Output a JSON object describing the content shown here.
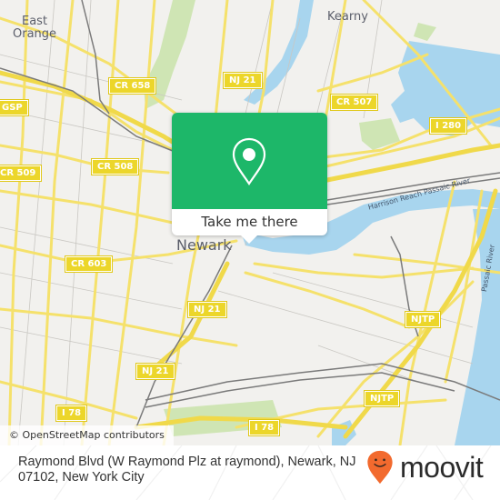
{
  "map": {
    "places": [
      {
        "name": "East Orange",
        "lines": [
          "East",
          "Orange"
        ]
      },
      {
        "name": "Kearny"
      },
      {
        "name": "Newark"
      }
    ],
    "road_shields": [
      {
        "id": "cr658",
        "label": "CR 658"
      },
      {
        "id": "nj21-top",
        "label": "NJ 21"
      },
      {
        "id": "cr507",
        "label": "CR 507"
      },
      {
        "id": "gsp",
        "label": "GSP"
      },
      {
        "id": "i280",
        "label": "I 280"
      },
      {
        "id": "cr509",
        "label": "CR 509"
      },
      {
        "id": "cr508",
        "label": "CR 508"
      },
      {
        "id": "cr603",
        "label": "CR 603"
      },
      {
        "id": "nj21-mid",
        "label": "NJ 21"
      },
      {
        "id": "njtp-upper",
        "label": "NJTP"
      },
      {
        "id": "nj21-low",
        "label": "NJ 21"
      },
      {
        "id": "njtp-lower",
        "label": "NJTP"
      },
      {
        "id": "i78-left",
        "label": "I 78"
      },
      {
        "id": "i78-right",
        "label": "I 78"
      }
    ],
    "water_labels": [
      {
        "id": "harrison-reach",
        "label": "Harrison Reach Passaic River"
      },
      {
        "id": "passaic-river",
        "label": "Passaic River"
      }
    ],
    "colors": {
      "land": "#f2f1ee",
      "water": "#a8d5ee",
      "park": "#cfe5b4",
      "road": "#f5e16b",
      "rail": "#7a7a7a",
      "shield": "#ecd62a"
    }
  },
  "popup": {
    "button_label": "Take me there",
    "icon": "map-pin-icon",
    "color": "#1db769"
  },
  "attribution": "© OpenStreetMap contributors",
  "footer": {
    "address": "Raymond Blvd (W Raymond Plz at raymond), Newark, NJ 07102, New York City",
    "brand": "moovit",
    "brand_color": "#f26a2e"
  }
}
